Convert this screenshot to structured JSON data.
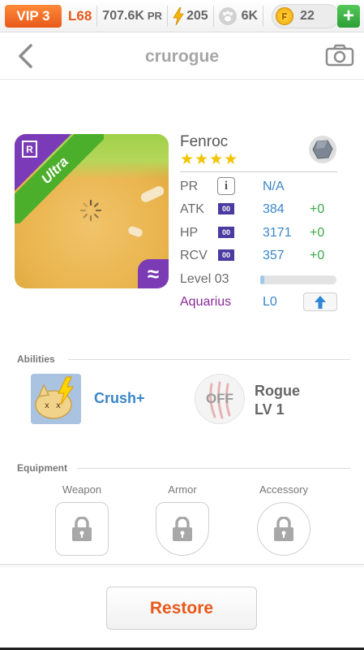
{
  "status_bar": {
    "vip_label": "VIP 3",
    "level": "L68",
    "pr_value": "707.6K",
    "pr_unit": "PR",
    "energy": "205",
    "paw_points": "6K",
    "coins": "22",
    "add_label": "+"
  },
  "header": {
    "title": "crurogue"
  },
  "card": {
    "rarity_letter": "R",
    "ribbon_text": "Ultra",
    "element_symbol": "≈"
  },
  "pet": {
    "name": "Fenroc",
    "stars": "★★★★",
    "stars_count": 4,
    "boost_tag": "00",
    "pr": {
      "label": "PR",
      "value": "N/A",
      "info": "i"
    },
    "atk": {
      "label": "ATK",
      "value": "384",
      "bonus": "+0"
    },
    "hp": {
      "label": "HP",
      "value": "3171",
      "bonus": "+0"
    },
    "rcv": {
      "label": "RCV",
      "value": "357",
      "bonus": "+0"
    },
    "level": {
      "label": "Level 03",
      "progress": 0.05
    },
    "sign": {
      "label": "Aquarius",
      "value": "L0"
    }
  },
  "abilities": {
    "section_title": "Abilities",
    "ability_name": "Crush+",
    "skill_state": "OFF",
    "skill_name": "Rogue",
    "skill_level": "LV 1"
  },
  "equipment": {
    "section_title": "Equipment",
    "weapon_label": "Weapon",
    "armor_label": "Armor",
    "accessory_label": "Accessory"
  },
  "actions": {
    "restore_label": "Restore"
  },
  "colors": {
    "accent": "#e8591a",
    "stat_value": "#3a86c8",
    "bonus": "#3aa84a",
    "ultra_ribbon": "#4caf2b",
    "rarity_purple": "#7b3bb8"
  }
}
